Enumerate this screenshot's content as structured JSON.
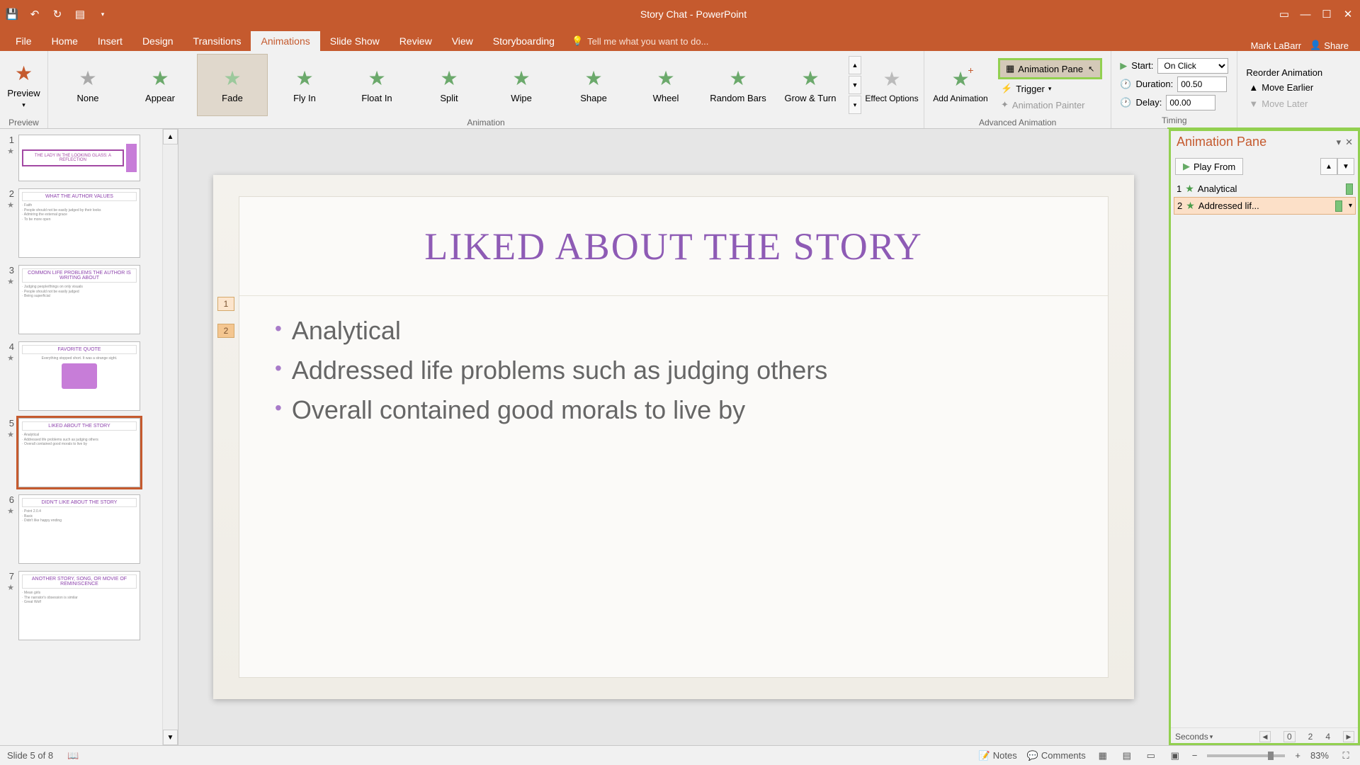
{
  "app": {
    "title": "Story Chat - PowerPoint",
    "user": "Mark LaBarr",
    "share": "Share"
  },
  "tabs": [
    "File",
    "Home",
    "Insert",
    "Design",
    "Transitions",
    "Animations",
    "Slide Show",
    "Review",
    "View",
    "Storyboarding"
  ],
  "active_tab": "Animations",
  "tellme": "Tell me what you want to do...",
  "ribbon": {
    "preview": "Preview",
    "preview_group": "Preview",
    "anims": [
      "None",
      "Appear",
      "Fade",
      "Fly In",
      "Float In",
      "Split",
      "Wipe",
      "Shape",
      "Wheel",
      "Random Bars",
      "Grow & Turn"
    ],
    "anim_selected": "Fade",
    "anim_group": "Animation",
    "effect_options": "Effect Options",
    "add_anim": "Add Animation",
    "anim_pane": "Animation Pane",
    "trigger": "Trigger",
    "anim_painter": "Animation Painter",
    "adv_group": "Advanced Animation",
    "start_lbl": "Start:",
    "start_val": "On Click",
    "duration_lbl": "Duration:",
    "duration_val": "00.50",
    "delay_lbl": "Delay:",
    "delay_val": "00.00",
    "timing_group": "Timing",
    "reorder": "Reorder Animation",
    "move_earlier": "Move Earlier",
    "move_later": "Move Later"
  },
  "thumbs": [
    {
      "n": "1",
      "title": "THE LADY IN THE LOOKING GLASS: A REFLECTION"
    },
    {
      "n": "2",
      "title": "WHAT THE AUTHOR VALUES"
    },
    {
      "n": "3",
      "title": "COMMON LIFE PROBLEMS THE AUTHOR IS WRITING ABOUT"
    },
    {
      "n": "4",
      "title": "FAVORITE QUOTE"
    },
    {
      "n": "5",
      "title": "LIKED ABOUT THE STORY"
    },
    {
      "n": "6",
      "title": "DIDN'T LIKE ABOUT THE STORY"
    },
    {
      "n": "7",
      "title": "ANOTHER STORY, SONG, OR MOVIE OF REMINISCENCE"
    }
  ],
  "slide": {
    "title": "LIKED ABOUT THE STORY",
    "bullets": [
      "Analytical",
      "Addressed life problems such as judging others",
      "Overall contained good morals to live by"
    ],
    "tags": [
      "1",
      "2"
    ]
  },
  "pane": {
    "title": "Animation Pane",
    "play": "Play From",
    "items": [
      {
        "n": "1",
        "label": "Analytical"
      },
      {
        "n": "2",
        "label": "Addressed lif..."
      }
    ],
    "seconds": "Seconds",
    "marks": [
      "0",
      "2",
      "4"
    ]
  },
  "status": {
    "slide": "Slide 5 of 8",
    "notes": "Notes",
    "comments": "Comments",
    "zoom": "83%"
  }
}
